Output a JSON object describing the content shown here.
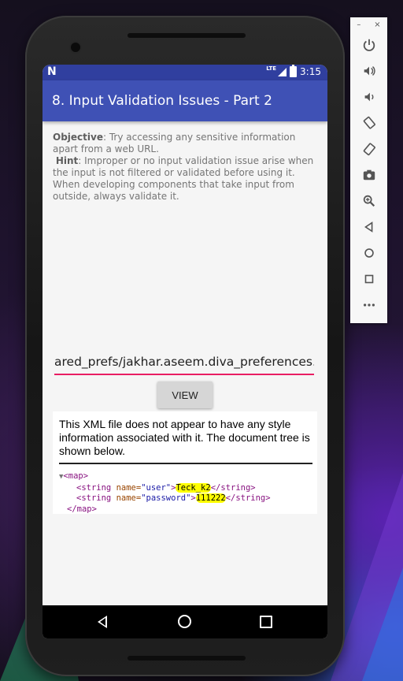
{
  "status_bar": {
    "time": "3:15",
    "network": "LTE",
    "logo": "N"
  },
  "app_bar": {
    "title": "8. Input Validation Issues - Part 2"
  },
  "content": {
    "objective_label": "Objective",
    "objective_text": ": Try accessing any sensitive information apart from a web URL.",
    "hint_label": "Hint",
    "hint_text": ": Improper or no input validation issue arise when the input is not filtered or validated before using it. When developing components that take input from outside, always validate it."
  },
  "url_input": {
    "value": "ared_prefs/jakhar.aseem.diva_preferences.xml"
  },
  "view_button": {
    "label": "VIEW"
  },
  "webview": {
    "note": "This XML file does not appear to have any style information associated with it. The document tree is shown below.",
    "xml": {
      "root_open": "<map>",
      "root_close": "</map>",
      "entries": [
        {
          "open": "<string ",
          "attr_name": "name=",
          "attr_value": "\"user\"",
          "gt": ">",
          "text": "Teck_k2",
          "close": "</string>"
        },
        {
          "open": "<string ",
          "attr_name": "name=",
          "attr_value": "\"password\"",
          "gt": ">",
          "text": "111222",
          "close": "</string>"
        }
      ]
    }
  },
  "nav_bar": {
    "icons": [
      "back-icon",
      "home-icon",
      "recents-icon"
    ]
  },
  "emulator_panel": {
    "controls": [
      "minimize",
      "close"
    ],
    "minimize_label": "–",
    "close_label": "×",
    "buttons": [
      "power-icon",
      "volume-up-icon",
      "volume-down-icon",
      "rotate-left-icon",
      "rotate-right-icon",
      "camera-icon",
      "zoom-icon",
      "back-icon",
      "home-icon",
      "overview-icon",
      "more-icon"
    ]
  },
  "colors": {
    "app_bar": "#3f51b5",
    "status_bar": "#303f9f",
    "input_underline": "#e91e63",
    "highlight": "#ffff00"
  }
}
